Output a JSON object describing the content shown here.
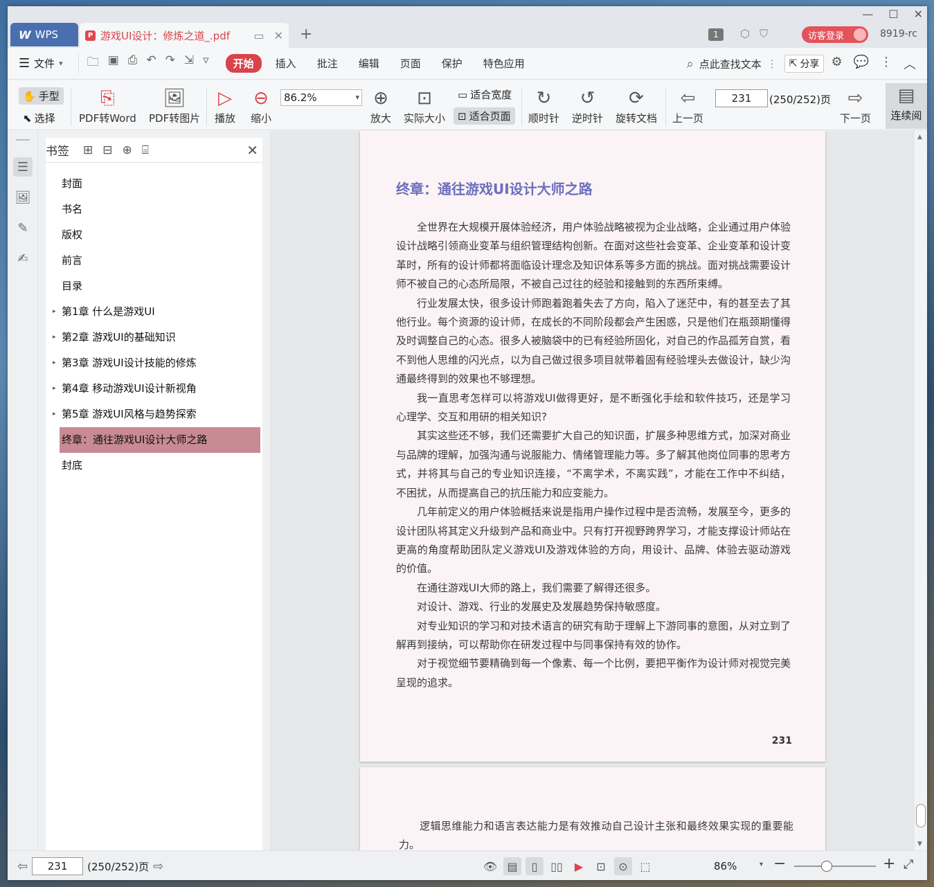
{
  "titlebar": {
    "app_tab": "WPS",
    "doc_tab": "游戏UI设计：修炼之道_.pdf",
    "page_count_badge": "1",
    "login_label": "访客登录",
    "user_id": "8919-rc"
  },
  "menubar": {
    "file_label": "文件",
    "tabs": [
      "开始",
      "插入",
      "批注",
      "编辑",
      "页面",
      "保护",
      "特色应用"
    ],
    "search_label": "点此查找文本",
    "share_label": "分享"
  },
  "toolbar": {
    "hand_label": "手型",
    "select_label": "选择",
    "pdf_to_word": "PDF转Word",
    "pdf_to_image": "PDF转图片",
    "play": "播放",
    "zoom_out": "缩小",
    "zoom_value": "86.2%",
    "zoom_in": "放大",
    "actual_size": "实际大小",
    "fit_width": "适合宽度",
    "fit_page": "适合页面",
    "clockwise": "顺时针",
    "counter_clockwise": "逆时针",
    "rotate_doc": "旋转文档",
    "prev_page": "上一页",
    "page_input": "231",
    "page_total": "(250/252)页",
    "next_page": "下一页",
    "continuous": "连续阅"
  },
  "bookmarks": {
    "title": "书签",
    "items": [
      {
        "label": "封面",
        "expandable": false
      },
      {
        "label": "书名",
        "expandable": false
      },
      {
        "label": "版权",
        "expandable": false
      },
      {
        "label": "前言",
        "expandable": false
      },
      {
        "label": "目录",
        "expandable": false
      },
      {
        "label": "第1章 什么是游戏UI",
        "expandable": true
      },
      {
        "label": "第2章 游戏UI的基础知识",
        "expandable": true
      },
      {
        "label": "第3章 游戏UI设计技能的修炼",
        "expandable": true
      },
      {
        "label": "第4章 移动游戏UI设计新视角",
        "expandable": true
      },
      {
        "label": "第5章 游戏UI风格与趋势探索",
        "expandable": true
      },
      {
        "label": "终章：通往游戏UI设计大师之路",
        "expandable": false,
        "selected": true
      },
      {
        "label": "封底",
        "expandable": false
      }
    ]
  },
  "document": {
    "page1": {
      "title": "终章：通往游戏UI设计大师之路",
      "paragraphs": [
        "全世界在大规模开展体验经济，用户体验战略被视为企业战略，企业通过用户体验设计战略引领商业变革与组织管理结构创新。在面对这些社会变革、企业变革和设计变革时，所有的设计师都将面临设计理念及知识体系等多方面的挑战。面对挑战需要设计师不被自己的心态所局限，不被自己过往的经验和接触到的东西所束缚。",
        "行业发展太快，很多设计师跑着跑着失去了方向，陷入了迷茫中，有的甚至去了其他行业。每个资源的设计师，在成长的不同阶段都会产生困惑，只是他们在瓶颈期懂得及时调整自己的心态。很多人被脑袋中的已有经验所固化，对自己的作品孤芳自赏，看不到他人思维的闪光点，以为自己做过很多项目就带着固有经验埋头去做设计，缺少沟通最终得到的效果也不够理想。",
        "我一直思考怎样可以将游戏UI做得更好，是不断强化手绘和软件技巧，还是学习心理学、交互和用研的相关知识?",
        "其实这些还不够，我们还需要扩大自己的知识面，扩展多种思维方式，加深对商业与品牌的理解，加强沟通与说服能力、情绪管理能力等。多了解其他岗位同事的思考方式，并将其与自己的专业知识连接，“不离学术，不离实践”，才能在工作中不纠结，不困扰，从而提高自己的抗压能力和应变能力。",
        "几年前定义的用户体验概括来说是指用户操作过程中是否流畅，发展至今，更多的设计团队将其定义升级到产品和商业中。只有打开视野跨界学习，才能支撑设计师站在更高的角度帮助团队定义游戏UI及游戏体验的方向，用设计、品牌、体验去驱动游戏的价值。",
        "在通往游戏UI大师的路上，我们需要了解得还很多。",
        "对设计、游戏、行业的发展史及发展趋势保持敏感度。",
        "对专业知识的学习和对技术语言的研究有助于理解上下游同事的意图，从对立到了解再到接纳，可以帮助你在研发过程中与同事保持有效的协作。",
        "对于视觉细节要精确到每一个像素、每一个比例，要把平衡作为设计师对视觉完美呈现的追求。"
      ],
      "page_number": "231"
    },
    "page2": {
      "paragraphs": [
        "逻辑思维能力和语言表达能力是有效推动自己设计主张和最终效果实现的重要能力。"
      ]
    }
  },
  "statusbar": {
    "page_input": "231",
    "page_total": "(250/252)页",
    "zoom": "86%",
    "zoom_slider_fraction": 0.4
  }
}
